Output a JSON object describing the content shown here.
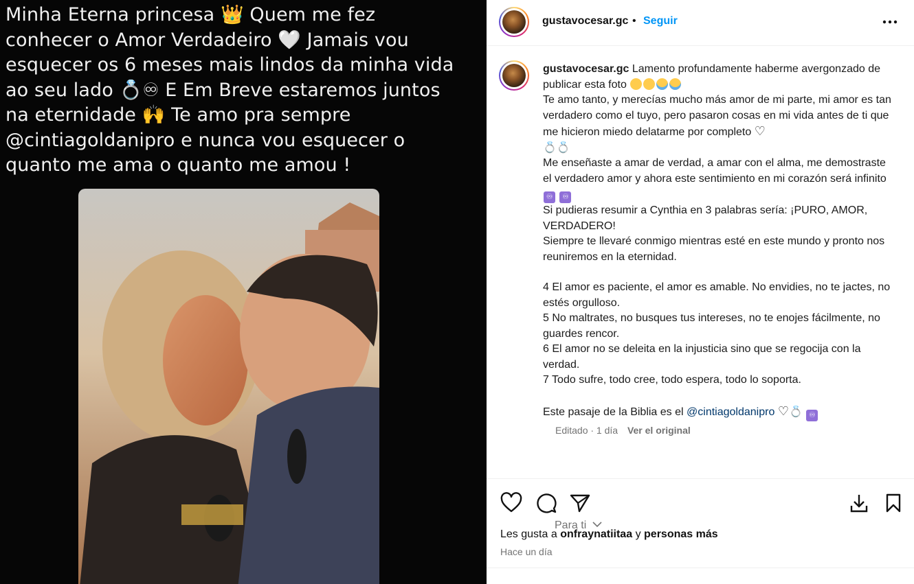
{
  "media": {
    "text": "Minha Eterna princesa 👑  Quem me fez\nconhecer o Amor Verdadeiro 🤍 Jamais vou\nesquecer os 6 meses mais lindos da minha vida\nao seu lado 💍♾ E Em Breve estaremos juntos\nna eternidade 🙌 Te amo pra sempre\n@cintiagoldanipro e nunca vou esquecer o\nquanto me ama o quanto me amou !"
  },
  "header": {
    "username": "gustavocesar.gc",
    "dot": "•",
    "follow_label": "Seguir"
  },
  "caption": {
    "username": "gustavocesar.gc",
    "line1": "Lamento profundamente haberme avergonzado de publicar esta foto",
    "para1": "Te amo tanto, y merecías mucho más amor de mi parte, mi amor es tan verdadero como el tuyo, pero pasaron cosas en mi vida antes de ti que me hicieron miedo delatarme por completo",
    "para2": "Me enseñaste a amar de verdad, a amar con el alma, me demostraste el verdadero amor y ahora este sentimiento en mi corazón será infinito",
    "para3": "Si pudieras resumir a Cynthia en 3 palabras sería: ¡PURO, AMOR, VERDADERO!",
    "para4": "Siempre te llevaré conmigo mientras esté en este mundo y pronto nos reuniremos en la eternidad.",
    "verse4": "4 El amor es paciente, el amor es amable. No envidies, no te jactes, no estés orgulloso.",
    "verse5": "5 No maltrates, no busques tus intereses, no te enojes fácilmente, no guardes rencor.",
    "verse6": "6 El amor no se deleita en la injusticia sino que se regocija con la verdad.",
    "verse7": "7 Todo sufre, todo cree, todo espera, todo lo soporta.",
    "closing_prefix": "Este pasaje de la Biblia es el",
    "closing_mention": "@cintiagoldanipro",
    "infinity": "♾"
  },
  "meta": {
    "edited": "Editado · 1 día",
    "see_original": "Ver el original"
  },
  "para_ti": "Para ti",
  "likes": {
    "prefix": "Les gusta a",
    "user": "onfraynatiitaa",
    "and": "y",
    "others": "personas más"
  },
  "time_ago": "Hace un día",
  "colors": {
    "follow": "#0095f6",
    "mention": "#00376b",
    "secondary": "#737373"
  },
  "icons": [
    "crown",
    "white-heart",
    "ring",
    "infinity",
    "raised-hands",
    "sad-face",
    "crying-face",
    "heart-outline",
    "infinity-box",
    "more",
    "like",
    "comment",
    "share",
    "download",
    "save"
  ]
}
